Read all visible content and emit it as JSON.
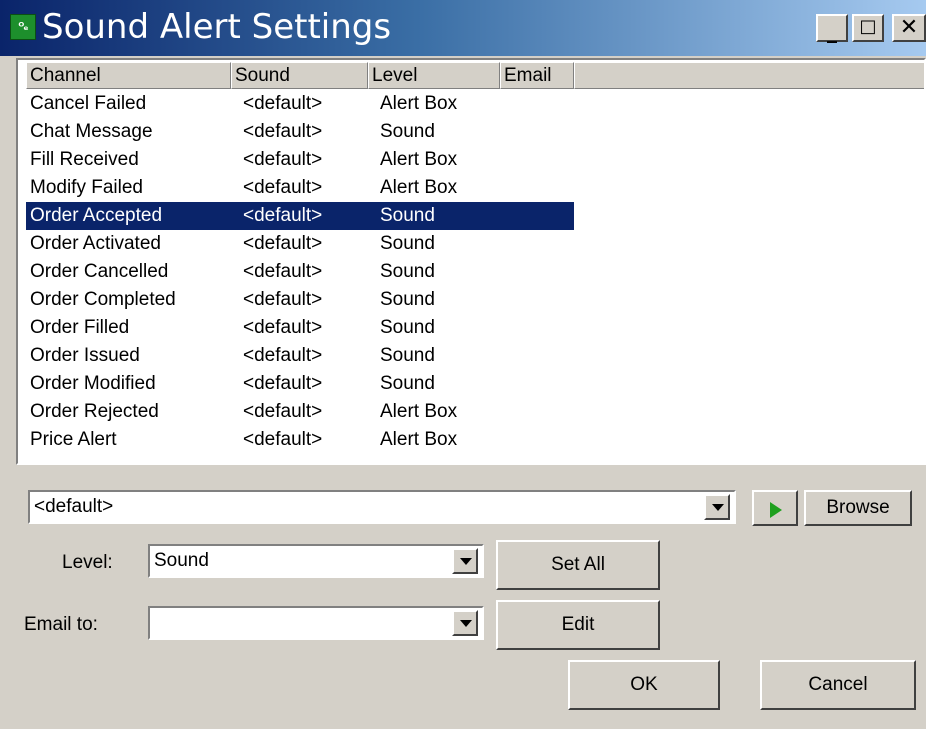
{
  "window": {
    "title": "Sound Alert Settings",
    "icon_glyph": "ᴼₑ"
  },
  "columns": [
    "Channel",
    "Sound",
    "Level",
    "Email"
  ],
  "rows": [
    {
      "channel": "Cancel Failed",
      "sound": "<default>",
      "level": "Alert Box",
      "email": ""
    },
    {
      "channel": "Chat Message",
      "sound": "<default>",
      "level": "Sound",
      "email": ""
    },
    {
      "channel": "Fill Received",
      "sound": "<default>",
      "level": "Alert Box",
      "email": ""
    },
    {
      "channel": "Modify Failed",
      "sound": "<default>",
      "level": "Alert Box",
      "email": ""
    },
    {
      "channel": "Order Accepted",
      "sound": "<default>",
      "level": "Sound",
      "email": "",
      "selected": true
    },
    {
      "channel": "Order Activated",
      "sound": "<default>",
      "level": "Sound",
      "email": ""
    },
    {
      "channel": "Order Cancelled",
      "sound": "<default>",
      "level": "Sound",
      "email": ""
    },
    {
      "channel": "Order Completed",
      "sound": "<default>",
      "level": "Sound",
      "email": ""
    },
    {
      "channel": "Order Filled",
      "sound": "<default>",
      "level": "Sound",
      "email": ""
    },
    {
      "channel": "Order Issued",
      "sound": "<default>",
      "level": "Sound",
      "email": ""
    },
    {
      "channel": "Order Modified",
      "sound": "<default>",
      "level": "Sound",
      "email": ""
    },
    {
      "channel": "Order Rejected",
      "sound": "<default>",
      "level": "Alert Box",
      "email": ""
    },
    {
      "channel": "Price Alert",
      "sound": "<default>",
      "level": "Alert Box",
      "email": ""
    }
  ],
  "sound_combo": {
    "value": "<default>"
  },
  "browse_label": "Browse",
  "level_label": "Level:",
  "level_combo": {
    "value": "Sound"
  },
  "set_all_label": "Set All",
  "email_label": "Email to:",
  "email_combo": {
    "value": ""
  },
  "edit_label": "Edit",
  "ok_label": "OK",
  "cancel_label": "Cancel",
  "colors": {
    "selection": "#0a246a",
    "dialog": "#d4d0c8",
    "play_icon": "#1fa01f"
  }
}
